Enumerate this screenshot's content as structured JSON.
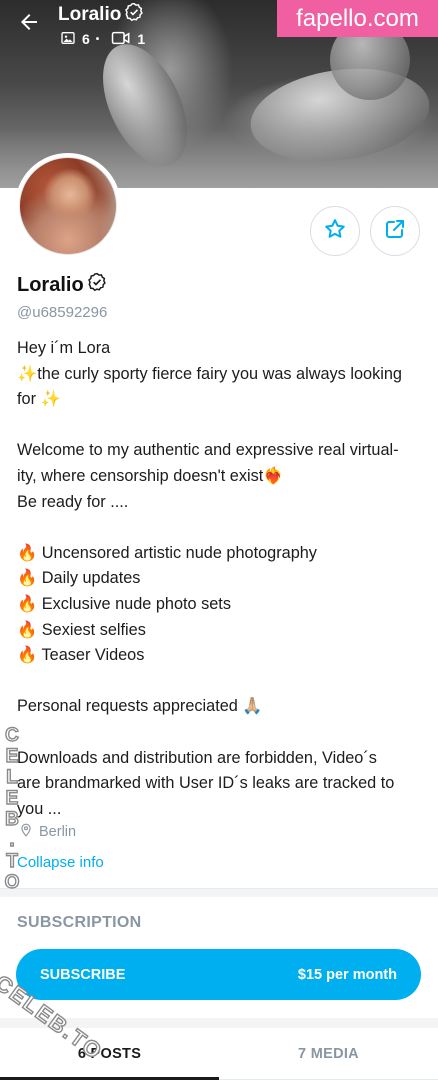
{
  "header": {
    "title": "Loralio",
    "photos_count": "6",
    "separator": "•",
    "videos_count": "1",
    "watermark": "fapello.com"
  },
  "profile": {
    "name": "Loralio",
    "handle": "@u68592296",
    "bio_lines": [
      "Hey i´m Lora",
      "✨the curly sporty fierce fairy you was always looking",
      "for ✨",
      "",
      "Welcome to my authentic and expressive real virtual-",
      "ity, where censorship doesn't exist❤️‍🔥",
      "Be ready for ....",
      "",
      "🔥 Uncensored artistic nude photography",
      "🔥 Daily updates",
      "🔥 Exclusive nude photo sets",
      "🔥 Sexiest selfies",
      "🔥 Teaser Videos",
      "",
      "Personal requests appreciated 🙏🏼",
      "",
      "Downloads and distribution are forbidden, Video´s",
      "are brandmarked with User ID´s leaks are tracked to",
      "you ..."
    ],
    "location": "Berlin",
    "collapse_label": "Collapse info"
  },
  "subscription": {
    "section_title": "SUBSCRIPTION",
    "button_label": "SUBSCRIBE",
    "price": "$15 per month"
  },
  "tabs": [
    {
      "label": "6 POSTS",
      "active": true
    },
    {
      "label": "7 MEDIA",
      "active": false
    }
  ],
  "watermarks": {
    "side": "CELEB.TO",
    "corner": "CELEB.TO"
  },
  "colors": {
    "accent": "#00aff0",
    "muted": "#8a96a3",
    "badge": "#f05fa2"
  },
  "icons": [
    "back-arrow-icon",
    "verified-icon",
    "image-icon",
    "video-icon",
    "star-icon",
    "share-icon",
    "location-pin-icon"
  ]
}
